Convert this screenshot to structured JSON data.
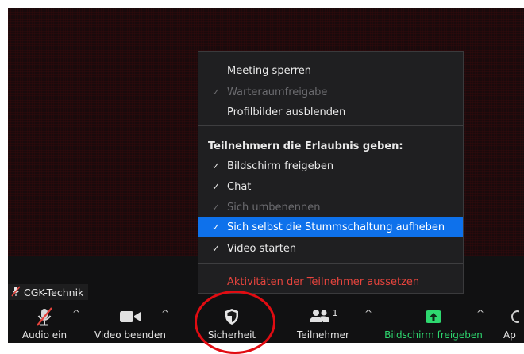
{
  "name_tag": {
    "label": "CGK-Technik",
    "icon": "muted-mic-icon"
  },
  "menu": {
    "top_items": [
      {
        "label": "Meeting sperren",
        "checked": false,
        "disabled": false
      },
      {
        "label": "Warteraumfreigabe",
        "checked": true,
        "disabled": true
      },
      {
        "label": "Profilbilder ausblenden",
        "checked": false,
        "disabled": false
      }
    ],
    "section_header": "Teilnehmern die Erlaubnis geben:",
    "permission_items": [
      {
        "label": "Bildschirm freigeben",
        "checked": true,
        "disabled": false,
        "selected": false
      },
      {
        "label": "Chat",
        "checked": true,
        "disabled": false,
        "selected": false
      },
      {
        "label": "Sich umbenennen",
        "checked": true,
        "disabled": true,
        "selected": false
      },
      {
        "label": "Sich selbst die Stummschaltung aufheben",
        "checked": true,
        "disabled": false,
        "selected": true
      },
      {
        "label": "Video starten",
        "checked": true,
        "disabled": false,
        "selected": false
      }
    ],
    "danger_item": "Aktivitäten der Teilnehmer aussetzen",
    "check_glyph": "✓"
  },
  "toolbar": {
    "audio": {
      "label": "Audio ein",
      "icon": "muted-mic-icon"
    },
    "video": {
      "label": "Video beenden",
      "icon": "video-camera-icon"
    },
    "security": {
      "label": "Sicherheit",
      "icon": "shield-icon"
    },
    "participants": {
      "label": "Teilnehmer",
      "count": "1",
      "icon": "participants-icon"
    },
    "share": {
      "label": "Bildschirm freigeben",
      "icon": "share-screen-icon"
    },
    "apps": {
      "label": "Ap"
    },
    "caret_glyph": "^"
  },
  "colors": {
    "selected": "#0e71eb",
    "danger": "#e5443d",
    "share_green": "#2ed86f",
    "annotation_red": "#e10c12"
  }
}
